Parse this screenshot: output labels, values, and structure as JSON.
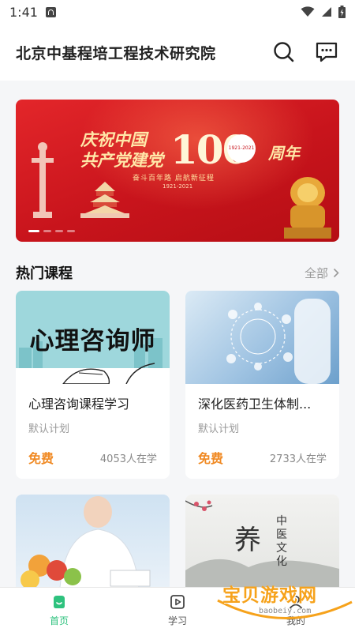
{
  "status_bar": {
    "time": "1:41"
  },
  "header": {
    "title": "北京中基程培工程技术研究院"
  },
  "banner": {
    "headline_line1": "庆祝中国",
    "headline_line2": "共产党建党",
    "number": "100",
    "suffix": "周年",
    "badge_text": "1921-2021",
    "slogan": "奋斗百年路 启航新征程",
    "years": "1921-2021",
    "dot_count": 4,
    "active_dot": 0
  },
  "section": {
    "title": "热门课程",
    "all_label": "全部"
  },
  "courses": [
    {
      "thumb_text": "心理咨询师",
      "title": "心理咨询课程学习",
      "plan": "默认计划",
      "price": "免费",
      "learners": "4053人在学"
    },
    {
      "title": "深化医药卫生体制...",
      "plan": "默认计划",
      "price": "免费",
      "learners": "2733人在学"
    },
    {
      "title": "",
      "plan": "",
      "price": "",
      "learners": ""
    },
    {
      "thumb_big": "养",
      "thumb_vertical": "中医文化",
      "title": "",
      "plan": "",
      "price": "",
      "learners": ""
    }
  ],
  "bottom_nav": [
    {
      "label": "首页",
      "icon": "home-icon",
      "active": true
    },
    {
      "label": "学习",
      "icon": "play-square-icon",
      "active": false
    },
    {
      "label": "我的",
      "icon": "user-icon",
      "active": false
    }
  ],
  "watermark": {
    "text": "宝贝游戏网",
    "url": "baobeiy.com"
  },
  "colors": {
    "accent": "#2ec27e",
    "price": "#f08a24",
    "banner_red": "#c8141c"
  }
}
